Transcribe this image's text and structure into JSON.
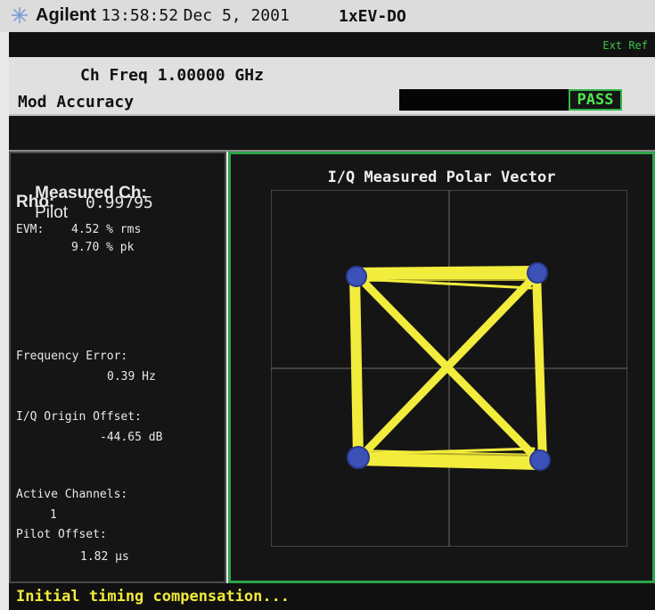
{
  "titlebar": {
    "brand": "Agilent",
    "time": "13:58:52",
    "date": "Dec 5, 2001",
    "mode": "1xEV-DO"
  },
  "header": {
    "ext_ref": "Ext Ref",
    "ch_freq": "Ch Freq 1.00000 GHz",
    "measurement": "Mod Accuracy",
    "result": "PASS"
  },
  "results": {
    "measured_ch_label": "Measured Ch:",
    "measured_ch_value": "Pilot",
    "rho_label": "Rho:",
    "rho_value": "0.99795",
    "evm_label": "EVM:",
    "evm_rms": "4.52 % rms",
    "evm_pk": "9.70 % pk",
    "freq_error_label": "Frequency Error:",
    "freq_error_value": "0.39 Hz",
    "iq_origin_label": "I/Q Origin Offset:",
    "iq_origin_value": "-44.65 dB",
    "active_channels_label": "Active Channels:",
    "active_channels_value": "1",
    "pilot_offset_label": "Pilot Offset:",
    "pilot_offset_value": "1.82 µs"
  },
  "graph": {
    "title": "I/Q Measured Polar Vector",
    "trace_color": "#f2ec3c",
    "symbol_color": "#3c52b8"
  },
  "status": {
    "message": "Initial timing compensation..."
  }
}
